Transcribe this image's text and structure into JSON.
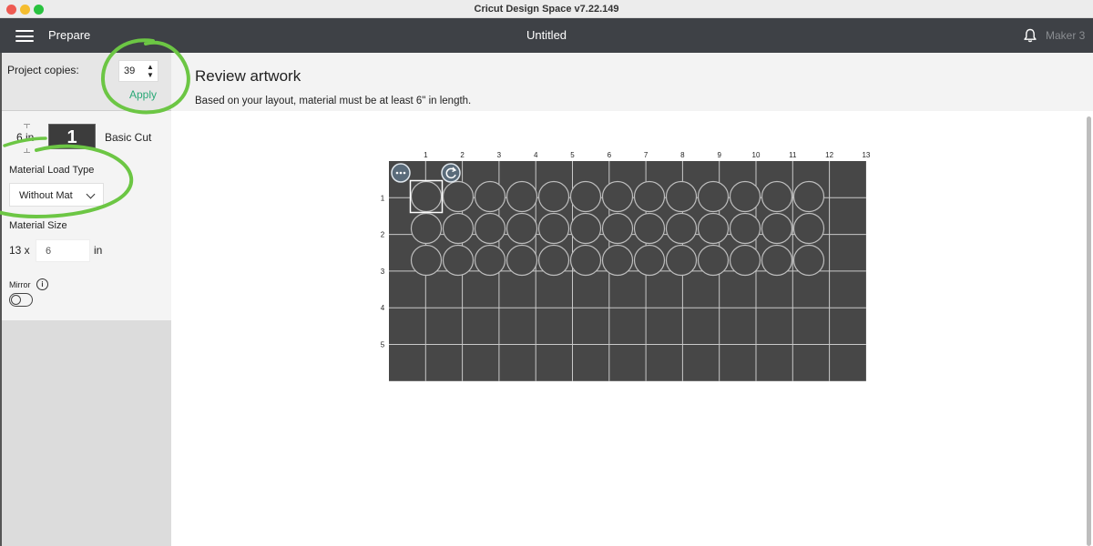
{
  "window": {
    "app_title": "Cricut Design Space  v7.22.149"
  },
  "topbar": {
    "menu_icon": "hamburger-menu-icon",
    "section_label": "Prepare",
    "document_title": "Untitled",
    "notification_icon": "bell-icon",
    "machine_label": "Maker 3"
  },
  "sidebar": {
    "copies_label": "Project copies:",
    "copies_value": "39",
    "stepper_up": "▲",
    "stepper_down": "▼",
    "apply_label": "Apply",
    "mat": {
      "length_label": "6 in",
      "mat_number": "1",
      "cut_type": "Basic Cut"
    },
    "material_load_type_label": "Material Load Type",
    "material_load_type_value": "Without Mat",
    "material_size_label": "Material Size",
    "material_width": "13 x",
    "material_length_value": "6",
    "material_unit": "in",
    "mirror_label": "Mirror",
    "mirror_info_icon": "i",
    "mirror_on": false
  },
  "main": {
    "title": "Review artwork",
    "subtitle": "Based on your layout, material must be at least 6\" in length."
  },
  "mat_preview": {
    "columns": [
      "1",
      "2",
      "3",
      "4",
      "5",
      "6",
      "7",
      "8",
      "9",
      "10",
      "11",
      "12",
      "13"
    ],
    "rows": [
      "1",
      "2",
      "3",
      "4",
      "5"
    ],
    "width_in": 13,
    "height_in": 6,
    "circle_rows": 3,
    "circle_cols": 13,
    "selected_index": 0,
    "more_icon": "more-options-icon",
    "rotate_icon": "rotate-icon",
    "mat_color": "#474747",
    "grid_color": "#c9c9c9"
  },
  "annotation_color": "#6cc644"
}
